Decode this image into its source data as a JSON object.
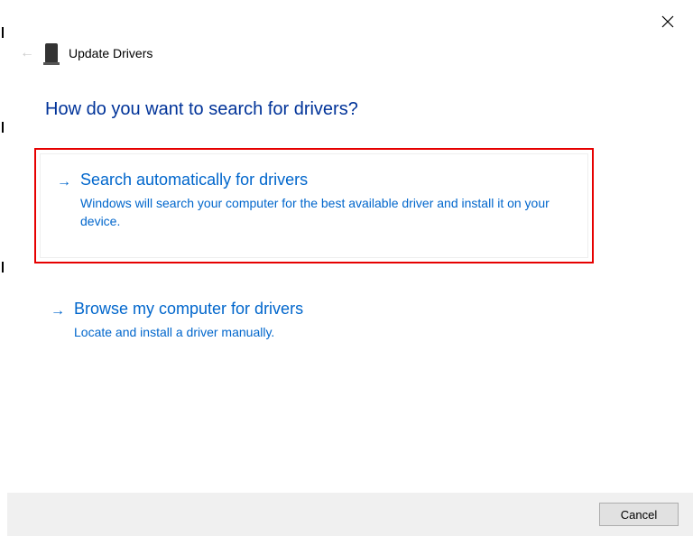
{
  "header": {
    "title": "Update Drivers"
  },
  "heading": "How do you want to search for drivers?",
  "options": {
    "auto": {
      "title": "Search automatically for drivers",
      "desc": "Windows will search your computer for the best available driver and install it on your device."
    },
    "browse": {
      "title": "Browse my computer for drivers",
      "desc": "Locate and install a driver manually."
    }
  },
  "footer": {
    "cancel": "Cancel"
  }
}
